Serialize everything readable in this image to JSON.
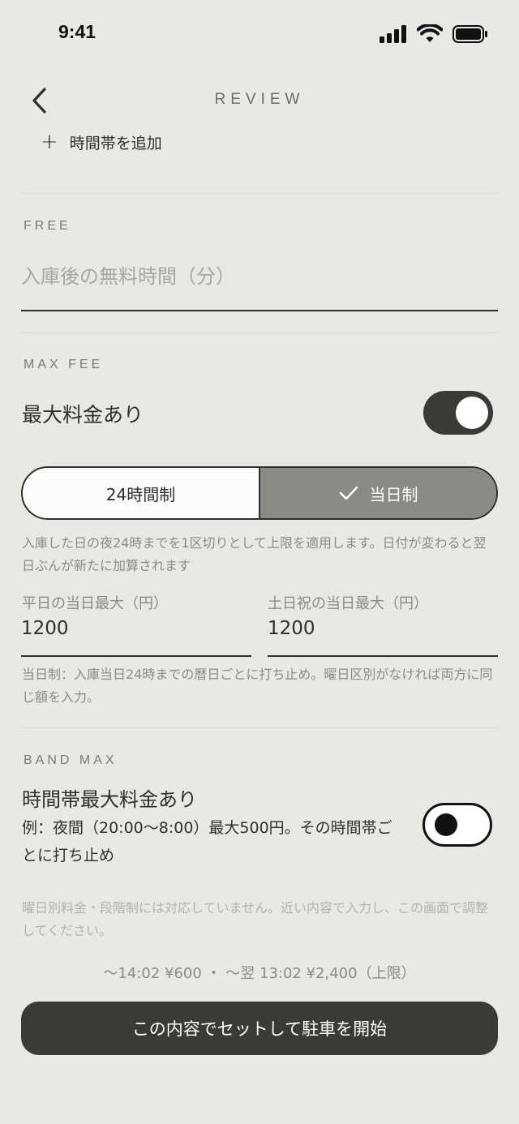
{
  "status_bar": {
    "time": "9:41"
  },
  "header": {
    "title": "REVIEW"
  },
  "add_slot": {
    "icon": "plus-icon",
    "label": "時間帯を追加"
  },
  "free": {
    "section_label": "FREE",
    "placeholder": "入庫後の無料時間（分）",
    "value": ""
  },
  "max_fee": {
    "section_label": "MAX FEE",
    "toggle_label": "最大料金あり",
    "toggle_on": true,
    "segments": [
      "24時間制",
      "当日制"
    ],
    "selected_segment": "当日制",
    "help": "入庫した日の夜24時までを1区切りとして上限を適用します。日付が変わると翌日ぶんが新たに加算されます",
    "weekday_label": "平日の当日最大（円）",
    "weekday_value": "1200",
    "holiday_label": "土日祝の当日最大（円）",
    "holiday_value": "1200",
    "note": "当日制：入庫当日24時までの暦日ごとに打ち止め。曜日区別がなければ両方に同じ額を入力。"
  },
  "band_max": {
    "section_label": "BAND MAX",
    "title": "時間帯最大料金あり",
    "description": "例：夜間（20:00〜8:00）最大500円。その時間帯ごとに打ち止め",
    "toggle_on": false
  },
  "footer_note": "曜日別料金・段階制には対応していません。近い内容で入力し、この画面で調整してください。",
  "summary": "〜14:02 ¥600 ・ 〜翌 13:02 ¥2,400（上限）",
  "cta_label": "この内容でセットして駐車を開始",
  "colors": {
    "accent_dark": "#3a3a37",
    "background": "#e8e8e4",
    "segment_selected": "#8a8a86"
  }
}
